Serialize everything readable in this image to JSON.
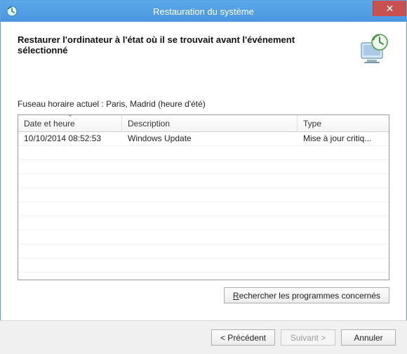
{
  "window": {
    "title": "Restauration du système",
    "close_icon": "✕"
  },
  "header": {
    "text": "Restaurer l'ordinateur à l'état où il se trouvait avant l'événement sélectionné"
  },
  "timezone_label": "Fuseau horaire actuel : Paris, Madrid (heure d'été)",
  "table": {
    "columns": {
      "date": "Date et heure",
      "description": "Description",
      "type": "Type"
    },
    "rows": [
      {
        "date": "10/10/2014 08:52:53",
        "description": "Windows Update",
        "type": "Mise à jour critiq..."
      }
    ]
  },
  "buttons": {
    "scan": "Rechercher les programmes concernés",
    "back": "< Précédent",
    "next": "Suivant >",
    "cancel": "Annuler"
  }
}
